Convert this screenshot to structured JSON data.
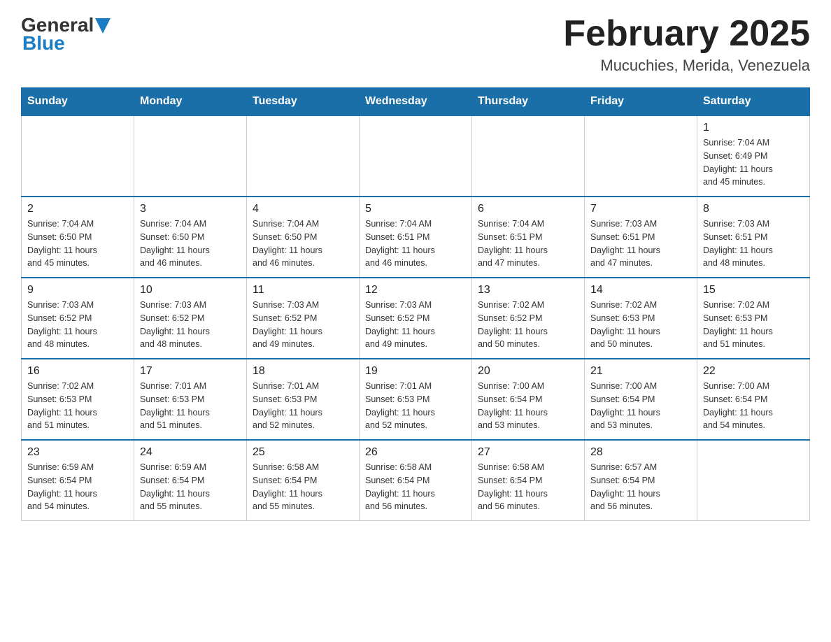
{
  "header": {
    "logo_general": "General",
    "logo_blue": "Blue",
    "month_title": "February 2025",
    "location": "Mucuchies, Merida, Venezuela"
  },
  "days_of_week": [
    "Sunday",
    "Monday",
    "Tuesday",
    "Wednesday",
    "Thursday",
    "Friday",
    "Saturday"
  ],
  "weeks": [
    [
      {
        "day": "",
        "info": ""
      },
      {
        "day": "",
        "info": ""
      },
      {
        "day": "",
        "info": ""
      },
      {
        "day": "",
        "info": ""
      },
      {
        "day": "",
        "info": ""
      },
      {
        "day": "",
        "info": ""
      },
      {
        "day": "1",
        "info": "Sunrise: 7:04 AM\nSunset: 6:49 PM\nDaylight: 11 hours\nand 45 minutes."
      }
    ],
    [
      {
        "day": "2",
        "info": "Sunrise: 7:04 AM\nSunset: 6:50 PM\nDaylight: 11 hours\nand 45 minutes."
      },
      {
        "day": "3",
        "info": "Sunrise: 7:04 AM\nSunset: 6:50 PM\nDaylight: 11 hours\nand 46 minutes."
      },
      {
        "day": "4",
        "info": "Sunrise: 7:04 AM\nSunset: 6:50 PM\nDaylight: 11 hours\nand 46 minutes."
      },
      {
        "day": "5",
        "info": "Sunrise: 7:04 AM\nSunset: 6:51 PM\nDaylight: 11 hours\nand 46 minutes."
      },
      {
        "day": "6",
        "info": "Sunrise: 7:04 AM\nSunset: 6:51 PM\nDaylight: 11 hours\nand 47 minutes."
      },
      {
        "day": "7",
        "info": "Sunrise: 7:03 AM\nSunset: 6:51 PM\nDaylight: 11 hours\nand 47 minutes."
      },
      {
        "day": "8",
        "info": "Sunrise: 7:03 AM\nSunset: 6:51 PM\nDaylight: 11 hours\nand 48 minutes."
      }
    ],
    [
      {
        "day": "9",
        "info": "Sunrise: 7:03 AM\nSunset: 6:52 PM\nDaylight: 11 hours\nand 48 minutes."
      },
      {
        "day": "10",
        "info": "Sunrise: 7:03 AM\nSunset: 6:52 PM\nDaylight: 11 hours\nand 48 minutes."
      },
      {
        "day": "11",
        "info": "Sunrise: 7:03 AM\nSunset: 6:52 PM\nDaylight: 11 hours\nand 49 minutes."
      },
      {
        "day": "12",
        "info": "Sunrise: 7:03 AM\nSunset: 6:52 PM\nDaylight: 11 hours\nand 49 minutes."
      },
      {
        "day": "13",
        "info": "Sunrise: 7:02 AM\nSunset: 6:52 PM\nDaylight: 11 hours\nand 50 minutes."
      },
      {
        "day": "14",
        "info": "Sunrise: 7:02 AM\nSunset: 6:53 PM\nDaylight: 11 hours\nand 50 minutes."
      },
      {
        "day": "15",
        "info": "Sunrise: 7:02 AM\nSunset: 6:53 PM\nDaylight: 11 hours\nand 51 minutes."
      }
    ],
    [
      {
        "day": "16",
        "info": "Sunrise: 7:02 AM\nSunset: 6:53 PM\nDaylight: 11 hours\nand 51 minutes."
      },
      {
        "day": "17",
        "info": "Sunrise: 7:01 AM\nSunset: 6:53 PM\nDaylight: 11 hours\nand 51 minutes."
      },
      {
        "day": "18",
        "info": "Sunrise: 7:01 AM\nSunset: 6:53 PM\nDaylight: 11 hours\nand 52 minutes."
      },
      {
        "day": "19",
        "info": "Sunrise: 7:01 AM\nSunset: 6:53 PM\nDaylight: 11 hours\nand 52 minutes."
      },
      {
        "day": "20",
        "info": "Sunrise: 7:00 AM\nSunset: 6:54 PM\nDaylight: 11 hours\nand 53 minutes."
      },
      {
        "day": "21",
        "info": "Sunrise: 7:00 AM\nSunset: 6:54 PM\nDaylight: 11 hours\nand 53 minutes."
      },
      {
        "day": "22",
        "info": "Sunrise: 7:00 AM\nSunset: 6:54 PM\nDaylight: 11 hours\nand 54 minutes."
      }
    ],
    [
      {
        "day": "23",
        "info": "Sunrise: 6:59 AM\nSunset: 6:54 PM\nDaylight: 11 hours\nand 54 minutes."
      },
      {
        "day": "24",
        "info": "Sunrise: 6:59 AM\nSunset: 6:54 PM\nDaylight: 11 hours\nand 55 minutes."
      },
      {
        "day": "25",
        "info": "Sunrise: 6:58 AM\nSunset: 6:54 PM\nDaylight: 11 hours\nand 55 minutes."
      },
      {
        "day": "26",
        "info": "Sunrise: 6:58 AM\nSunset: 6:54 PM\nDaylight: 11 hours\nand 56 minutes."
      },
      {
        "day": "27",
        "info": "Sunrise: 6:58 AM\nSunset: 6:54 PM\nDaylight: 11 hours\nand 56 minutes."
      },
      {
        "day": "28",
        "info": "Sunrise: 6:57 AM\nSunset: 6:54 PM\nDaylight: 11 hours\nand 56 minutes."
      },
      {
        "day": "",
        "info": ""
      }
    ]
  ]
}
